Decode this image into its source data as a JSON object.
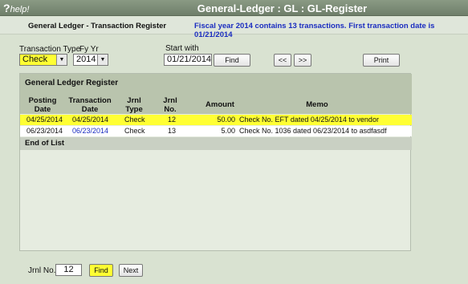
{
  "app": {
    "help_label": "help!",
    "help_mark": "?",
    "title": "General-Ledger : GL : GL-Register"
  },
  "header": {
    "form_title": "General Ledger - Transaction Register",
    "fiscal_info": "Fiscal year 2014 contains 13 transactions. First transaction date is 01/21/2014"
  },
  "filters": {
    "transaction_type_label": "Transaction Type",
    "transaction_type_value": "Check",
    "fy_label": "Fy Yr",
    "fy_value": "2014",
    "start_with_label": "Start with",
    "start_with_value": "01/21/2014",
    "find_label": "Find",
    "prev_label": "<<",
    "next_label": ">>",
    "print_label": "Print"
  },
  "register": {
    "title": "General Ledger Register",
    "columns": {
      "posting_date": [
        "Posting",
        "Date"
      ],
      "transaction_date": [
        "Transaction",
        "Date"
      ],
      "jrnl_type": [
        "Jrnl",
        "Type"
      ],
      "jrnl_no": [
        "Jrnl",
        "No."
      ],
      "amount": "Amount",
      "memo": "Memo"
    },
    "rows": [
      {
        "posting_date": "04/25/2014",
        "transaction_date": "04/25/2014",
        "jrnl_type": "Check",
        "jrnl_no": "12",
        "amount": "50.00",
        "memo": "Check No. EFT dated 04/25/2014 to vendor"
      },
      {
        "posting_date": "06/23/2014",
        "transaction_date": "06/23/2014",
        "jrnl_type": "Check",
        "jrnl_no": "13",
        "amount": "5.00",
        "memo": "Check No. 1036 dated 06/23/2014 to asdfasdf"
      }
    ],
    "end_label": "End of List"
  },
  "footer": {
    "jrnl_no_label": "Jrnl No.",
    "jrnl_no_value": "12",
    "find_label": "Find",
    "next_label": "Next"
  },
  "colors": {
    "highlight": "#ffff33",
    "link": "#1a2cc0",
    "titlebar": "#7b8b76",
    "panel_header": "#b9c4ad"
  }
}
